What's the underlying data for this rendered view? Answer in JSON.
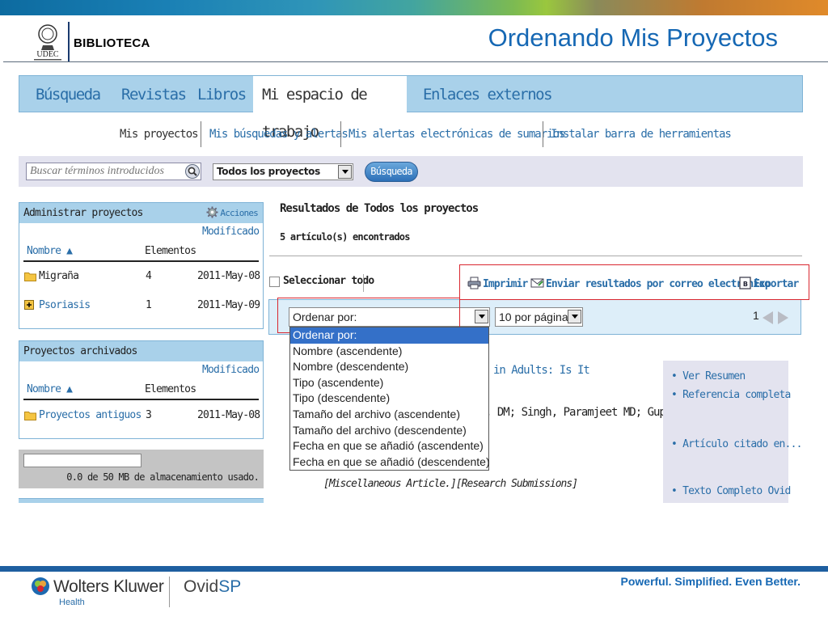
{
  "header": {
    "org_name": "BIBLIOTECA",
    "logo_text": "UDEC",
    "slide_title": "Ordenando Mis Proyectos"
  },
  "nav": {
    "tabs": [
      {
        "label": "Búsqueda"
      },
      {
        "label": "Revistas"
      },
      {
        "label": "Libros"
      },
      {
        "label": "Mi espacio de trabajo",
        "active": true
      },
      {
        "label": "Enlaces externos"
      }
    ]
  },
  "subnav": {
    "items": [
      {
        "label": "Mis proyectos",
        "active": true
      },
      {
        "label": "Mis búsquedas y alertas"
      },
      {
        "label": "Mis alertas electrónicas de sumarios"
      },
      {
        "label": "Instalar barra de herramientas"
      }
    ]
  },
  "search": {
    "placeholder": "Buscar términos introducidos",
    "project_select": "Todos los proyectos",
    "button_label": "Búsqueda"
  },
  "manage_panel": {
    "title": "Administrar proyectos",
    "actions_label": "Acciones",
    "col_modified": "Modificado",
    "col_name": "Nombre ▲",
    "col_items": "Elementos",
    "rows": [
      {
        "name": "Migraña",
        "items": "4",
        "date": "2011-May-08"
      },
      {
        "name": "Psoriasis",
        "items": "1",
        "date": "2011-May-09"
      }
    ]
  },
  "archived_panel": {
    "title": "Proyectos archivados",
    "col_modified": "Modificado",
    "col_name": "Nombre ▲",
    "col_items": "Elementos",
    "rows": [
      {
        "name": "Proyectos antiguos",
        "items": "3",
        "date": "2011-May-08"
      }
    ]
  },
  "storage": {
    "text": "0.0 de 50 MB de almacenamiento usado.",
    "fraction": 0.0
  },
  "results": {
    "title": "Resultados de Todos los proyectos",
    "count": "5 artículo(s) encontrados",
    "select_all": "Seleccionar todo",
    "print": "Imprimir",
    "email": "Enviar resultados por correo electrónico",
    "export": "Exportar",
    "sort_select": "Ordenar por:",
    "perpage_select": "10 por página",
    "page": "1",
    "sort_options": [
      "Ordenar por:",
      "Nombre (ascendente)",
      "Nombre (descendente)",
      "Tipo (ascendente)",
      "Tipo (descendente)",
      "Tamaño del archivo (ascendente)",
      "Tamaño del archivo (descendente)",
      "Fecha en que se añadió (ascendente)",
      "Fecha en que se añadió (descendente)"
    ],
    "title_fragment": "in Adults: Is It",
    "author_fragment": ", DM; Singh, Paramjeet MD; Gupta,",
    "pub_type": "[Miscellaneous Article.][Research Submissions]",
    "side_links": [
      "Ver Resumen",
      "Referencia completa",
      "Artículo citado en...",
      "Texto Completo Ovid"
    ]
  },
  "footer": {
    "brand": "Wolters Kluwer",
    "brand_sub": "Health",
    "product_a": "Ovid",
    "product_b": "SP",
    "tagline": "Powerful. Simplified. Even Better."
  }
}
